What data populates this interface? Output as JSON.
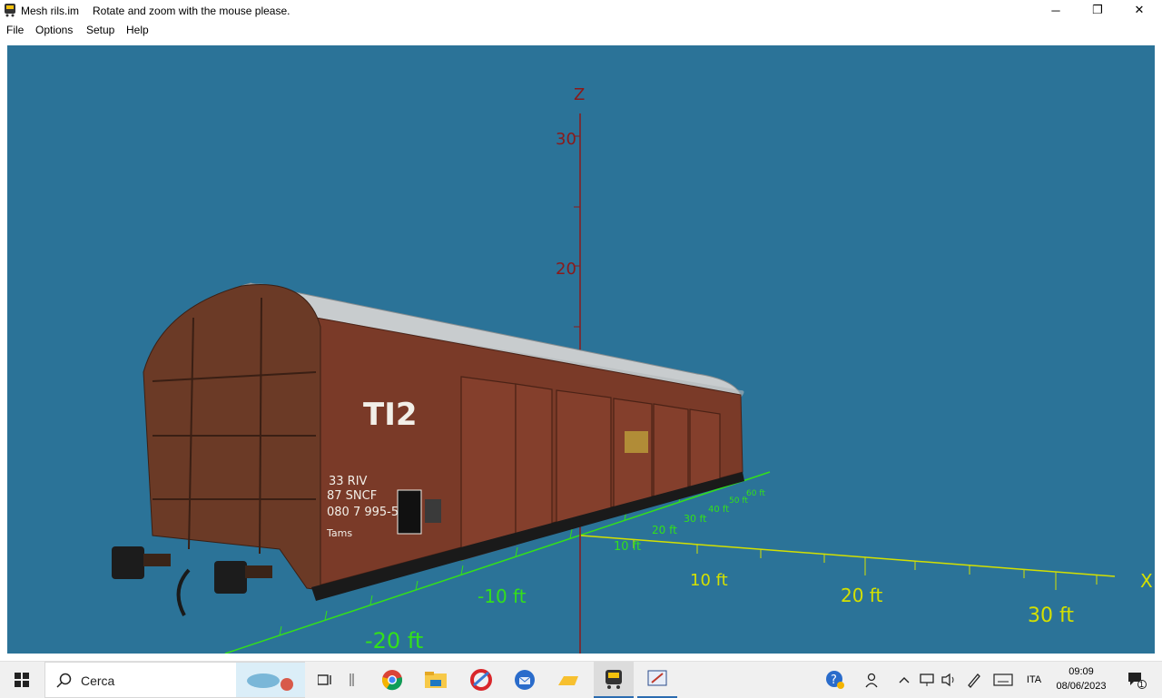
{
  "window": {
    "title": "Mesh rils.im",
    "hint": "Rotate and zoom with the mouse please.",
    "controls": {
      "minimize": "─",
      "restore": "❐",
      "close": "✕"
    }
  },
  "menu": {
    "items": [
      "File",
      "Options",
      "Setup",
      "Help"
    ]
  },
  "viewport": {
    "background": "#2b7398",
    "axes": {
      "z_label": "Z",
      "x_label": "X",
      "z_ticks": [
        "30",
        "20"
      ],
      "x_ticks": [
        "10 ft",
        "20 ft",
        "30 ft"
      ],
      "y_ticks_front": [
        "-10 ft",
        "-20 ft"
      ],
      "y_ticks_back": [
        "-10",
        "10 ft",
        "20 ft",
        "30 ft",
        "40 ft",
        "50 ft",
        "60 ft"
      ],
      "z_color": "#8b1a1a",
      "x_color": "#d4e000",
      "y_color": "#33e01a"
    },
    "wagon": {
      "code": "TI2",
      "marking_1": "33 RIV",
      "marking_2": "87 SNCF",
      "marking_3": "080 7 995-5",
      "marking_4": "Tams",
      "body_color": "#7a3a28",
      "roof_color": "#c8ccce"
    }
  },
  "taskbar": {
    "search_placeholder": "Cerca",
    "language": "ITA",
    "time": "09:09",
    "date": "08/06/2023",
    "notification_count": "1",
    "icons": [
      "start-icon",
      "search-icon",
      "task-view-icon",
      "chrome-icon",
      "file-explorer-icon",
      "ccleaner-icon",
      "thunderbird-icon",
      "onedrive-icon",
      "train-app-icon",
      "editor-app-icon"
    ]
  }
}
